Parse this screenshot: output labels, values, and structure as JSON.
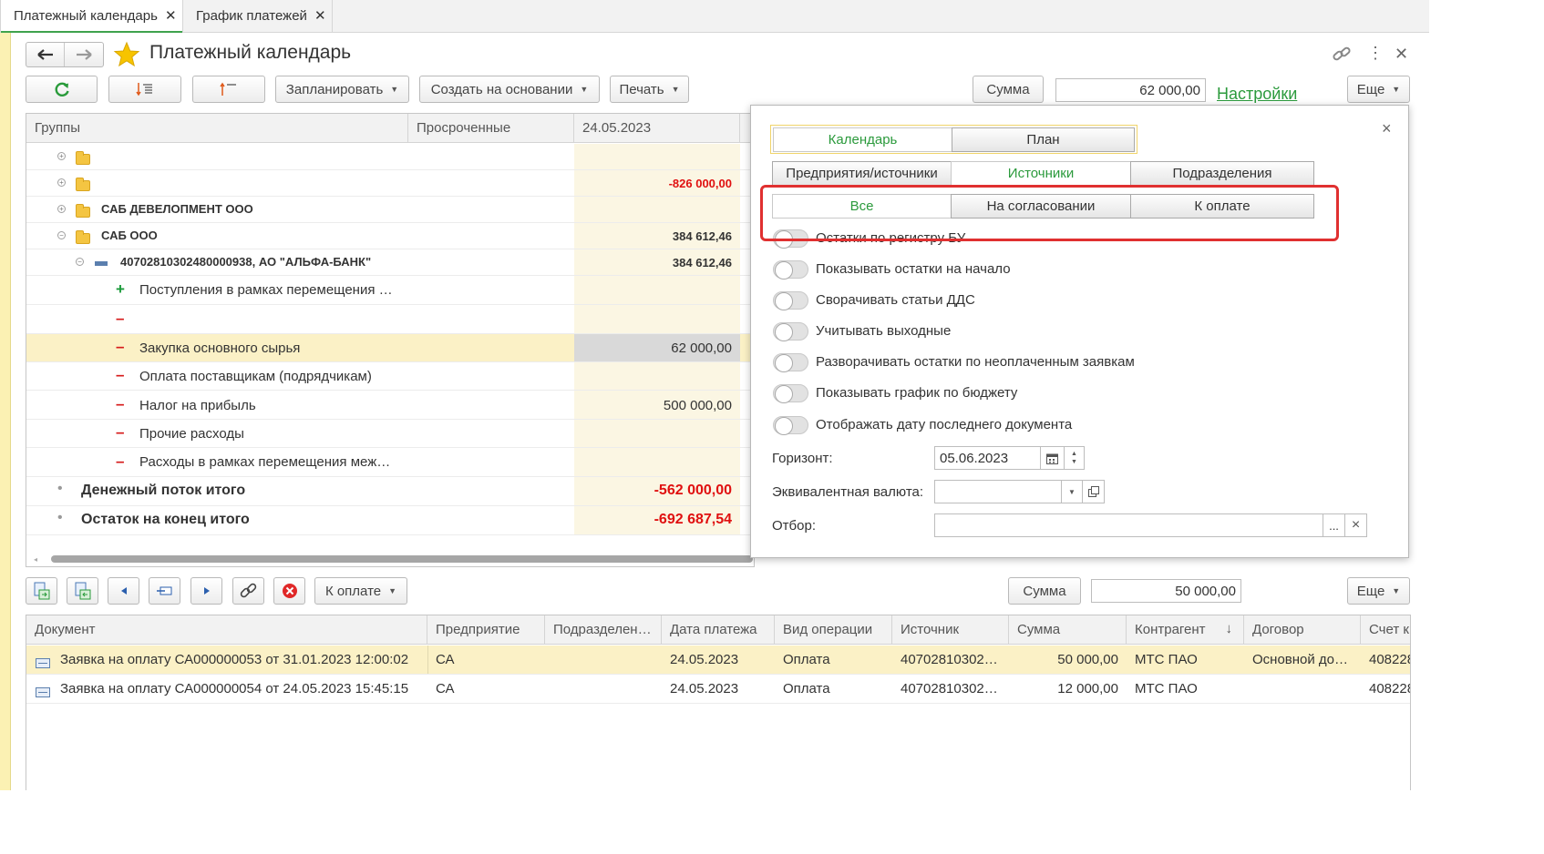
{
  "tabs": [
    {
      "label": "Платежный календарь",
      "close": "✕"
    },
    {
      "label": "График платежей",
      "close": "✕"
    }
  ],
  "header": {
    "title": "Платежный календарь",
    "back_icon": "arrow-left-icon",
    "forward_icon": "arrow-right-icon",
    "favorite_icon": "star-icon"
  },
  "toolbar": {
    "plan_label": "Запланировать",
    "create_label": "Создать на основании",
    "print_label": "Печать",
    "sum_label": "Сумма",
    "sum_value": "62 000,00",
    "settings_link": "Настройки",
    "more_label": "Еще"
  },
  "grid": {
    "columns": [
      "Группы",
      "Просроченные",
      "24.05.2023"
    ],
    "rows": [
      {
        "name": "",
        "date_value": "",
        "sign": ""
      },
      {
        "name": "",
        "date_value": "-826 000,00",
        "sign": ""
      },
      {
        "name": "САБ ДЕВЕЛОПМЕНТ ООО",
        "date_value": "",
        "sign": ""
      },
      {
        "name": "САБ ООО",
        "date_value": "384 612,46",
        "sign": ""
      },
      {
        "name": "40702810302480000938, АО \"АЛЬФА-БАНК\"",
        "date_value": "384 612,46",
        "sign": ""
      },
      {
        "name": "Поступления в рамках перемещения …",
        "date_value": "",
        "sign": "+"
      },
      {
        "name": "",
        "date_value": "",
        "sign": "–"
      },
      {
        "name": "Закупка основного сырья",
        "date_value": "62 000,00",
        "sign": "–"
      },
      {
        "name": "Оплата поставщикам (подрядчикам)",
        "date_value": "",
        "sign": "–"
      },
      {
        "name": "Налог на прибыль",
        "date_value": "500 000,00",
        "sign": "–"
      },
      {
        "name": "Прочие расходы",
        "date_value": "",
        "sign": "–"
      },
      {
        "name": "Расходы в рамках перемещения меж…",
        "date_value": "",
        "sign": "–"
      },
      {
        "name": "Денежный поток итого",
        "date_value": "-562 000,00",
        "sign": "•"
      },
      {
        "name": "Остаток на конец итого",
        "date_value": "-692 687,54",
        "sign": "•"
      }
    ]
  },
  "popup": {
    "close": "×",
    "view_tabs": [
      "Календарь",
      "План"
    ],
    "group_tabs": [
      "Предприятия/источники",
      "Источники",
      "Подразделения"
    ],
    "filter_tabs": [
      "Все",
      "На согласовании",
      "К оплате"
    ],
    "toggles": [
      "Остатки по регистру БУ",
      "Показывать остатки на начало",
      "Сворачивать статьи ДДС",
      "Учитывать выходные",
      "Разворачивать остатки по неоплаченным заявкам",
      "Показывать график по бюджету",
      "Отображать дату последнего документа"
    ],
    "horizon_label": "Горизонт:",
    "horizon_value": "05.06.2023",
    "currency_label": "Эквивалентная валюта:",
    "currency_value": "",
    "filter_label": "Отбор:",
    "filter_value": "",
    "dots": "...",
    "clear": "×"
  },
  "bottom_toolbar": {
    "filter_label": "К оплате",
    "sum_label": "Сумма",
    "sum_value": "50 000,00",
    "more_label": "Еще"
  },
  "documents": {
    "columns": [
      "Документ",
      "Предприятие",
      "Подразделен…",
      "Дата платежа",
      "Вид операции",
      "Источник",
      "Сумма",
      "Контрагент",
      "Договор",
      "Счет к"
    ],
    "sort_arrow": "↓",
    "rows": [
      [
        "Заявка на оплату СА000000053 от 31.01.2023 12:00:02",
        "СА",
        "",
        "24.05.2023",
        "Оплата",
        "40702810302…",
        "50 000,00",
        "МТС ПАО",
        "Основной до…",
        "408228"
      ],
      [
        "Заявка на оплату СА000000054 от 24.05.2023 15:45:15",
        "СА",
        "",
        "24.05.2023",
        "Оплата",
        "40702810302…",
        "12 000,00",
        "МТС ПАО",
        "",
        "408228"
      ]
    ]
  }
}
